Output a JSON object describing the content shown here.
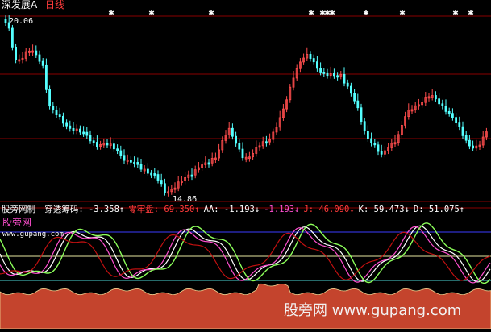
{
  "header": {
    "stock_name": "深发展A",
    "period": "日线"
  },
  "price_chart": {
    "high_label": "20.06",
    "low_label": "14.86",
    "signal_glyph": "✱"
  },
  "indicator_bar": {
    "source": "股旁网制",
    "items": [
      {
        "label": "穿透筹码:",
        "value": "-3.358",
        "arrow": "↑",
        "color": "#ffffff"
      },
      {
        "label": "零牢盘:",
        "value": "69.350",
        "arrow": "↑",
        "color": "#ff3b3b"
      },
      {
        "label": "AA:",
        "value": "-1.193",
        "arrow": "↓",
        "color": "#ffffff"
      },
      {
        "label": "",
        "value": "-1.193",
        "arrow": "↓",
        "color": "#ff4fd0"
      },
      {
        "label": "J:",
        "value": "46.090",
        "arrow": "↓",
        "color": "#ff3b3b"
      },
      {
        "label": "K:",
        "value": "59.473",
        "arrow": "↓",
        "color": "#ffffff"
      },
      {
        "label": "D:",
        "value": "51.075",
        "arrow": "↑",
        "color": "#ffffff"
      }
    ]
  },
  "sub_panel": {
    "logo_text": "股旁网",
    "url_text": "www.gupang.com"
  },
  "watermark": {
    "text": "股旁网 www.gupang.com"
  },
  "colors": {
    "up_candle": "#ff4d4d",
    "down_candle": "#54ffff",
    "ref_line": "#8a0000",
    "fill": "#c4442d",
    "signal": "#ffffff"
  }
}
